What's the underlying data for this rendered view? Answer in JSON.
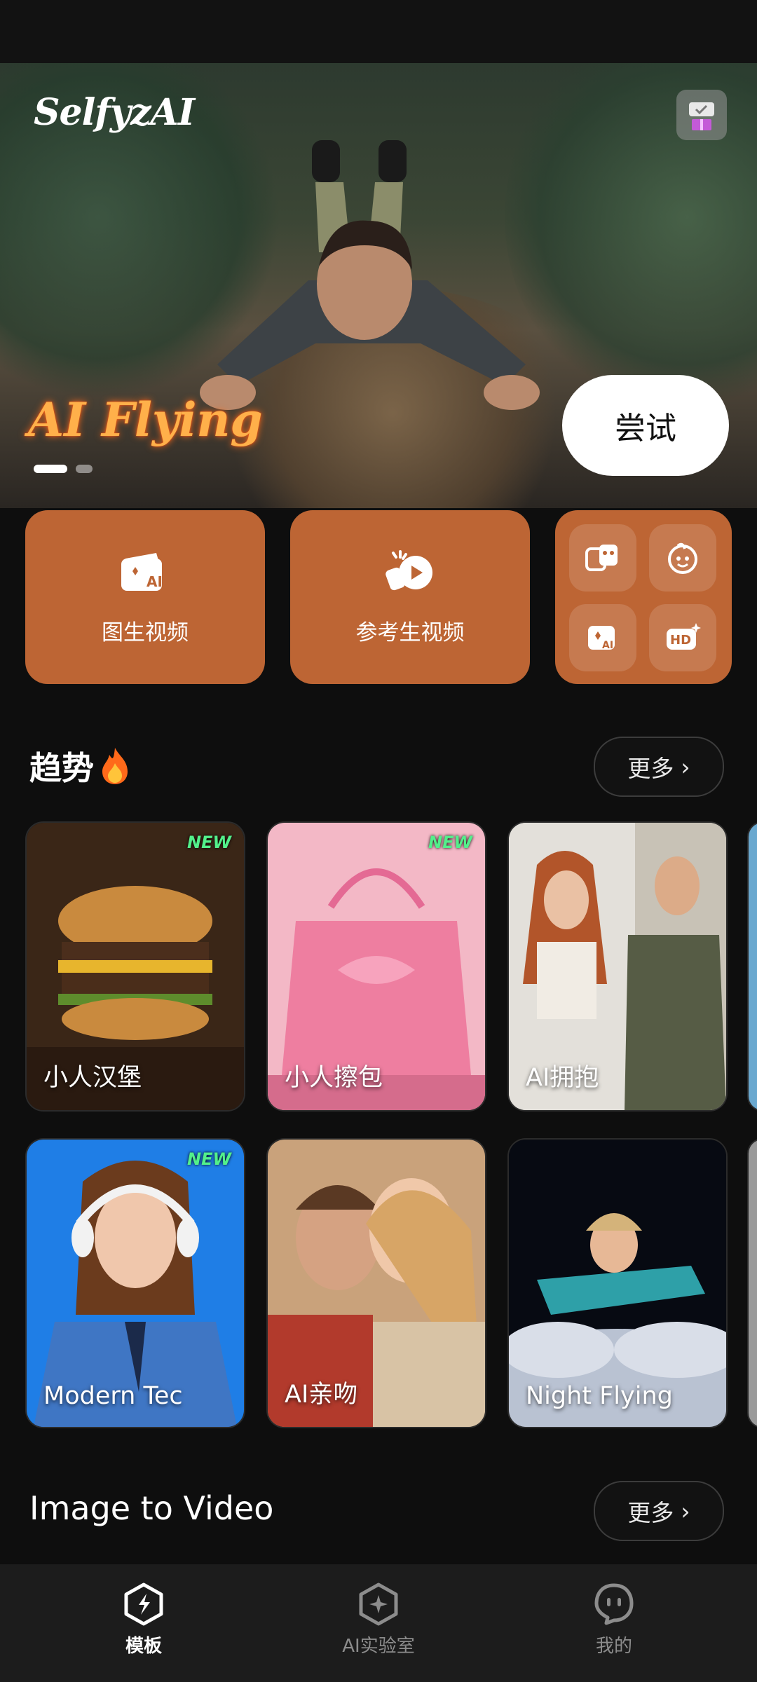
{
  "hero": {
    "logo": "SelfyzAI",
    "title": "AI Flying",
    "try_label": "尝试",
    "slide_count": 2,
    "active_slide": 1
  },
  "features": {
    "tile1_label": "图生视频",
    "tile2_label": "参考生视频",
    "mini_icons": [
      "face-swap-icon",
      "baby-face-icon",
      "ai-image-icon",
      "hd-enhance-icon"
    ]
  },
  "trending": {
    "title": "趋势",
    "more_label": "更多",
    "cards": [
      {
        "label": "小人汉堡",
        "badge": "NEW"
      },
      {
        "label": "小人擦包",
        "badge": "NEW"
      },
      {
        "label": "AI拥抱",
        "badge": ""
      },
      {
        "label": "Modern Tec",
        "badge": "NEW"
      },
      {
        "label": "AI亲吻",
        "badge": ""
      },
      {
        "label": "Night Flying",
        "badge": ""
      }
    ]
  },
  "image_to_video": {
    "title": "Image to Video",
    "more_label": "更多"
  },
  "nav": {
    "items": [
      {
        "label": "模板",
        "icon": "template-icon",
        "active": true
      },
      {
        "label": "AI实验室",
        "icon": "ai-lab-icon",
        "active": false
      },
      {
        "label": "我的",
        "icon": "profile-icon",
        "active": false
      }
    ]
  },
  "colors": {
    "accent": "#bd6534",
    "background": "#0e0e0e",
    "new_badge": "#53f08b"
  }
}
